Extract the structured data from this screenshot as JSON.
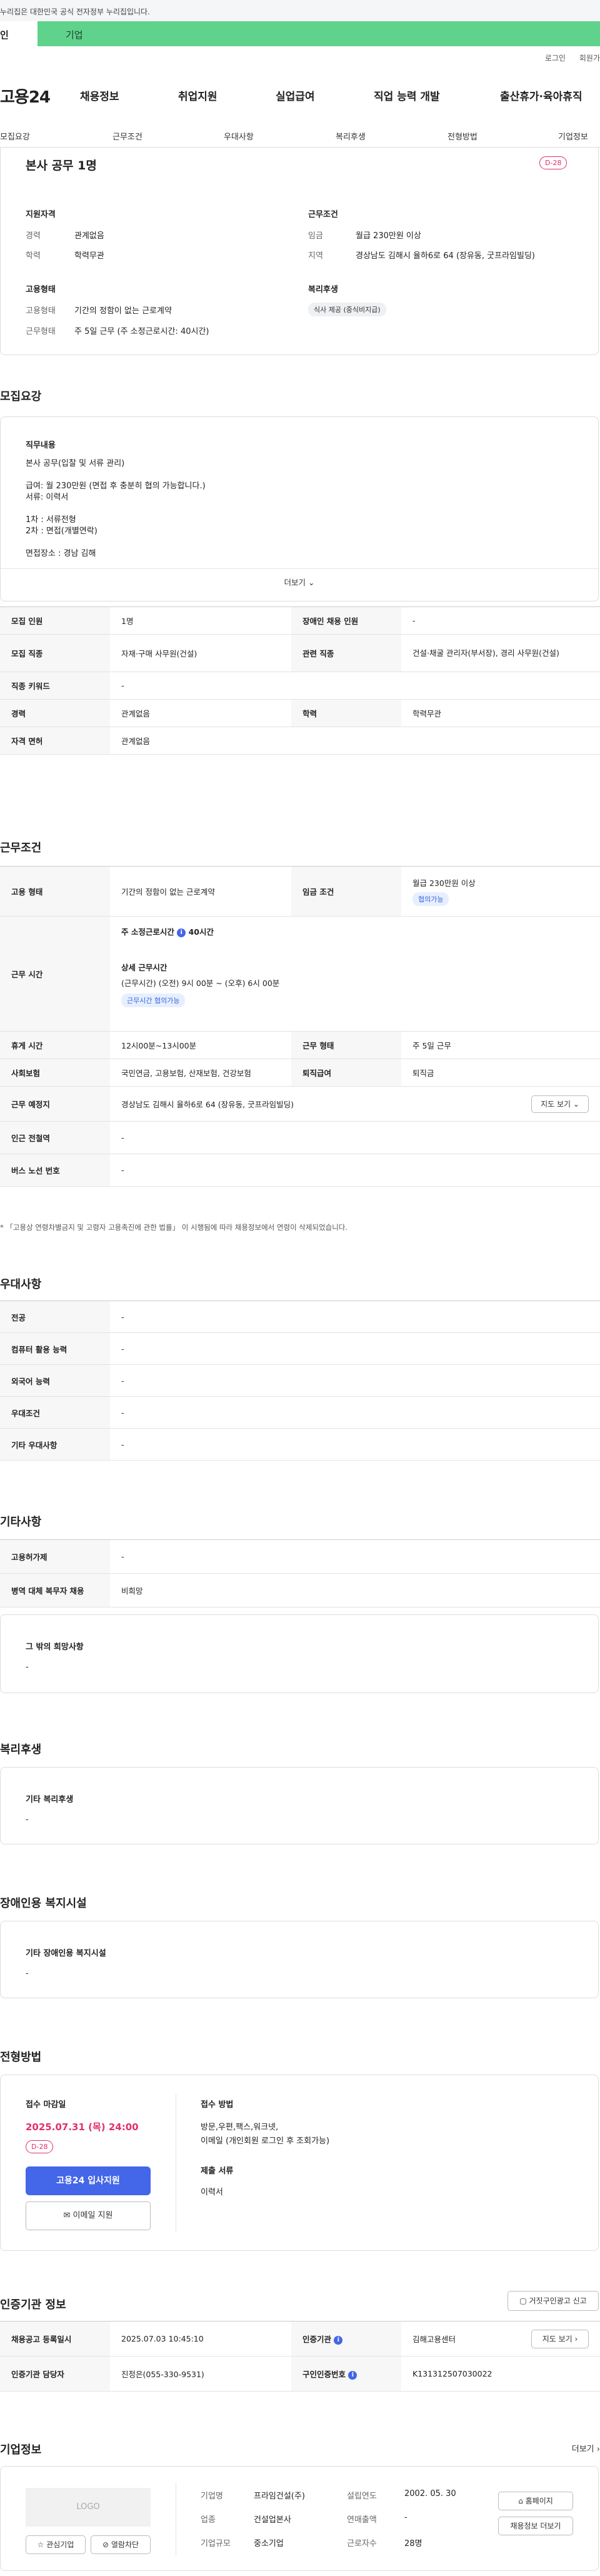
{
  "gov_banner": "누리집은 대한민국 공식 전자정부 누리집입니다.",
  "util_tabs": [
    "인",
    "기업"
  ],
  "top_links": [
    "로그인",
    "회원가"
  ],
  "logo": "고용24",
  "gnb": [
    "채용정보",
    "취업지원",
    "실업급여",
    "직업 능력 개발",
    "출산휴가·육아휴직"
  ],
  "tabs": [
    "모집요강",
    "근무조건",
    "우대사항",
    "복리후생",
    "전형방법",
    "기업정보"
  ],
  "summary": {
    "title": "본사 공무 1명",
    "dday": "D-28",
    "qual_heading": "지원자격",
    "career_label": "경력",
    "career_value": "관계없음",
    "edu_label": "학력",
    "edu_value": "학력무관",
    "cond_heading": "근무조건",
    "wage_label": "임금",
    "wage_value": "월급 230만원 이상",
    "region_label": "지역",
    "region_value": "경상남도 김해시 율하6로 64 (장유동, 굿프라임빌딩)",
    "emp_heading": "고용형태",
    "emp_type_label": "고용형태",
    "emp_type_value": "기간의 정함이 없는 근로계약",
    "work_type_label": "근무형태",
    "work_type_value": "주 5일 근무 (주 소정근로시간: 40시간)",
    "welfare_heading": "복리후생",
    "welfare_chip": "식사 제공 (중식비지급)"
  },
  "recruit": {
    "heading": "모집요강",
    "job_title": "직무내용",
    "job_lines": [
      "본사 공무(입찰 및 서류 관리)",
      "",
      "급여: 월 230만원 (면접 후 충분히 협의 가능합니다.)",
      "서류: 이력서",
      "",
      "1차 : 서류전형",
      "2차 : 면접(개별연락)",
      "",
      "면접장소 : 경남 김해"
    ],
    "more": "더보기",
    "rows": [
      [
        "모집 인원",
        "1명",
        "장애인 채용 인원",
        "-"
      ],
      [
        "모집 직종",
        "자재·구매 사무원(건설)",
        "관련 직종",
        "건설·채굴 관리자(부서장), 경리 사무원(건설)"
      ],
      [
        "직종 키워드",
        "-"
      ],
      [
        "경력",
        "관계없음",
        "학력",
        "학력무관"
      ],
      [
        "자격 면허",
        "관계없음"
      ]
    ]
  },
  "work": {
    "heading": "근무조건",
    "emp_type_label": "고용 형태",
    "emp_type": "기간의 정함이 없는 근로계약",
    "wage_label": "임금 조건",
    "wage": "월급 230만원 이상",
    "wage_chip": "협의가능",
    "hours_label": "근무 시간",
    "weekly": "주 소정근로시간",
    "weekly_val": "40시간",
    "detail_title": "상세 근무시간",
    "detail": "(근무시간) (오전) 9시 00분 ~ (오후) 6시 00분",
    "detail_chip": "근무시간 협의가능",
    "rest_label": "휴게 시간",
    "rest": "12시00분~13시00분",
    "form_label": "근무 형태",
    "form": "주 5일 근무",
    "ins_label": "사회보험",
    "ins": "국민연금, 고용보험, 산재보험, 건강보험",
    "sev_label": "퇴직급여",
    "sev": "퇴직금",
    "place_label": "근무 예정지",
    "place": "경상남도 김해시 율하6로 64 (장유동, 굿프라임빌딩)",
    "map_btn": "지도 보기",
    "subway_label": "인근 전철역",
    "subway": "-",
    "bus_label": "버스 노선 번호",
    "bus": "-",
    "note": "* 「고용상 연령차별금지 및 고령자 고용촉진에 관한 법률」 이 시행됨에 따라 채용정보에서 연령이 삭제되었습니다."
  },
  "pref": {
    "heading": "우대사항",
    "rows": [
      [
        "전공",
        "-"
      ],
      [
        "컴퓨터 활용 능력",
        "-"
      ],
      [
        "외국어 능력",
        "-"
      ],
      [
        "우대조건",
        "-"
      ],
      [
        "기타 우대사항",
        "-"
      ]
    ]
  },
  "etc": {
    "heading": "기타사항",
    "rows": [
      [
        "고용허가제",
        "-"
      ],
      [
        "병역 대체 복무자 채용",
        "비희망"
      ]
    ],
    "other_title": "그 밖의 희망사항",
    "other_value": "-"
  },
  "welfare": {
    "heading": "복리후생",
    "title": "기타 복리후생",
    "value": "-"
  },
  "disabled": {
    "heading": "장애인용 복지시설",
    "title": "기타 장애인용 복지시설",
    "value": "-"
  },
  "screening": {
    "heading": "전형방법",
    "deadline_label": "접수 마감일",
    "deadline": "2025.07.31 (목) 24:00",
    "dday": "D-28",
    "apply_btn": "고용24 입사지원",
    "email_btn": "이메일 지원",
    "method_label": "접수 방법",
    "method1": "방문,우편,팩스,워크넷,",
    "method2": "이메일 (개인회원 로그인 후 조회가능)",
    "docs_label": "제출 서류",
    "docs": "이력서"
  },
  "agency": {
    "heading": "인증기관 정보",
    "report_btn": "거짓구인광고 신고",
    "reg_label": "채용공고 등록일시",
    "reg": "2025.07.03 10:45:10",
    "org_label": "인증기관",
    "org": "김해고용센터",
    "map_btn": "지도 보기",
    "mgr_label": "인증기관 담당자",
    "mgr": "진정은(055-330-9531)",
    "no_label": "구인인증번호",
    "no": "K131312507030022"
  },
  "company": {
    "heading": "기업정보",
    "more": "더보기",
    "logo": "LOGO",
    "fav_btn": "관심기업",
    "block_btn": "열람차단",
    "name_label": "기업명",
    "name": "프라임건설(주)",
    "ind_label": "업종",
    "ind": "건설업본사",
    "size_label": "기업규모",
    "size": "중소기업",
    "est_label": "설립연도",
    "est": "2002. 05. 30",
    "sales_label": "연매출액",
    "sales": "-",
    "emp_label": "근로자수",
    "emp": "28명",
    "home_btn": "홈페이지",
    "jobs_btn": "채용정보 더보기"
  }
}
